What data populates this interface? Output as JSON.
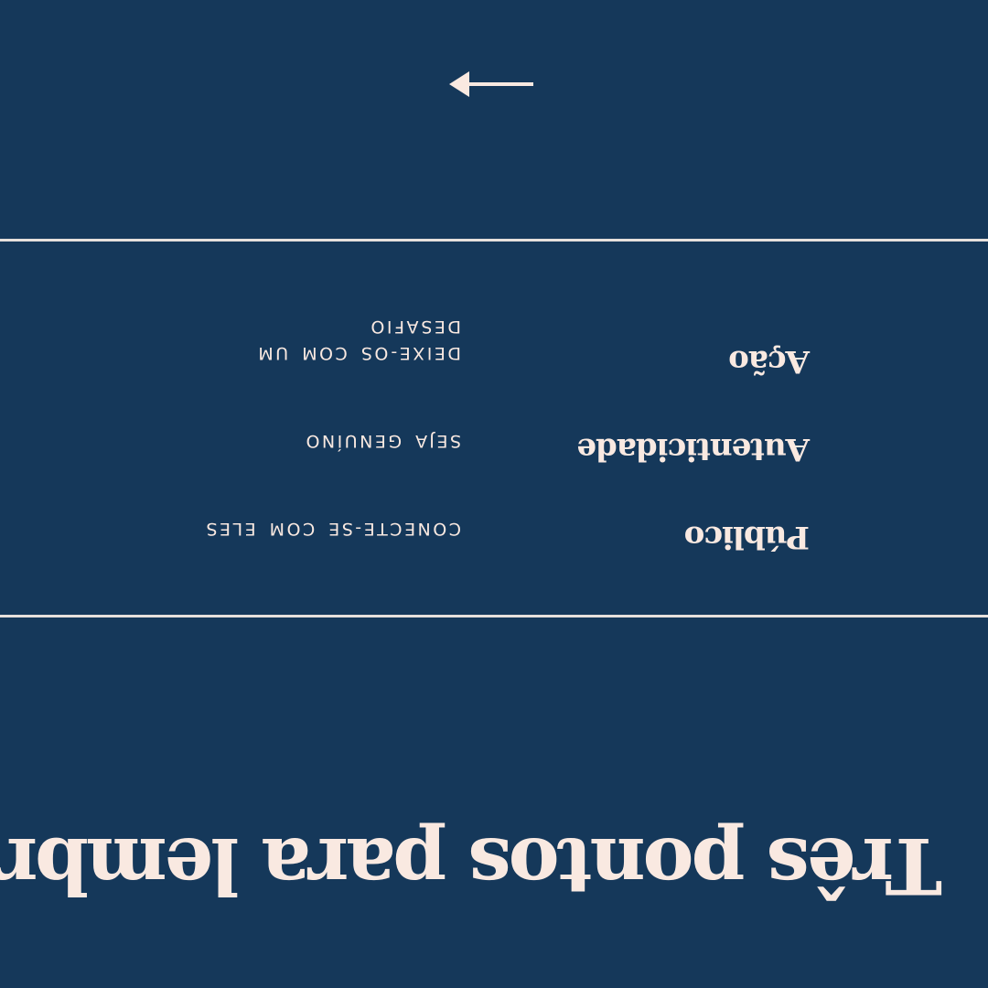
{
  "slide": {
    "title": "Três pontos para lembrar",
    "points": [
      {
        "label": "Público",
        "description": "CONECTE-SE COM ELES"
      },
      {
        "label": "Autenticidade",
        "description": "SEJA GENUÍNO"
      },
      {
        "label": "Ação",
        "description": "DEIXE-OS COM UM DESAFIO"
      }
    ],
    "next_icon": "arrow-right-icon",
    "colors": {
      "background": "#15385a",
      "text": "#f9e9e1",
      "divider": "#e6e0dc"
    }
  }
}
